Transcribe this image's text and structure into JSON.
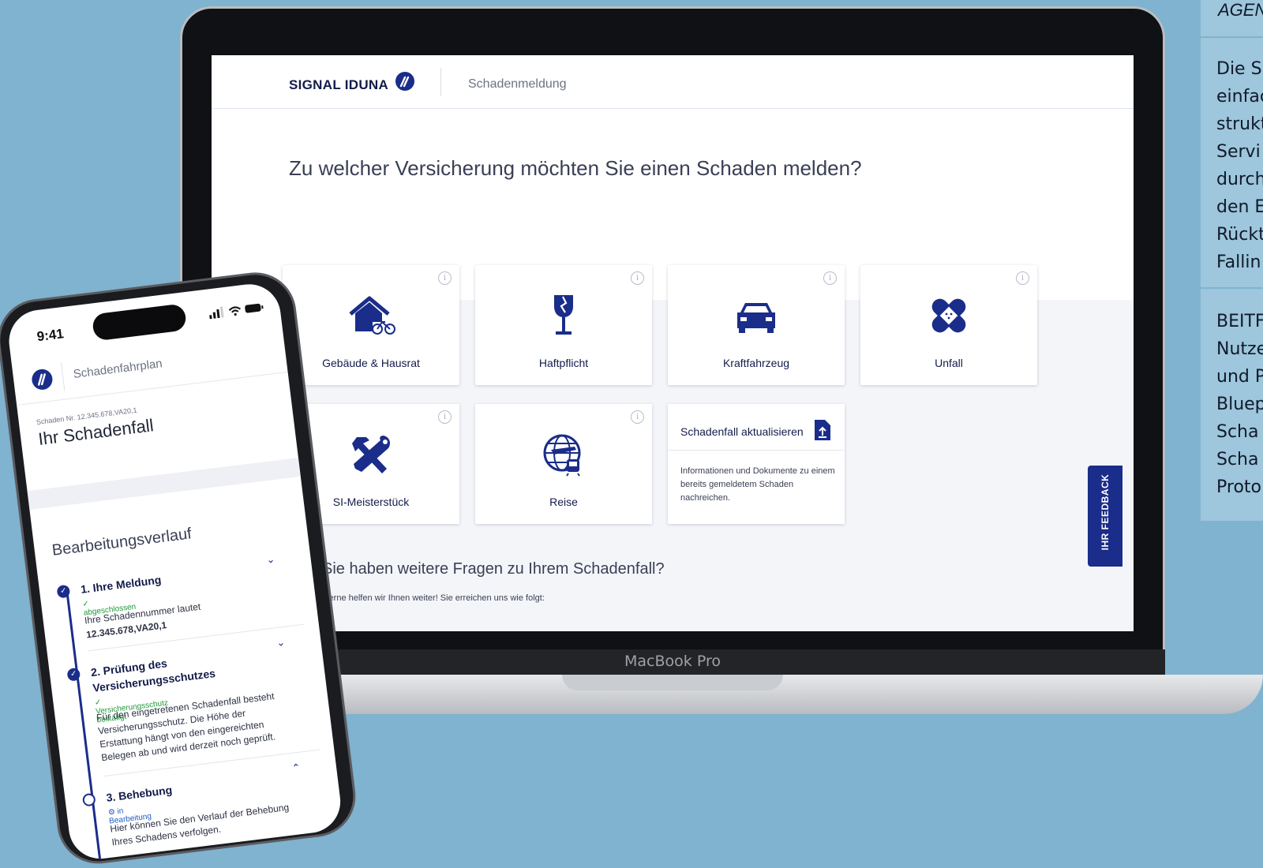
{
  "side_panel": {
    "agency": "AGEN",
    "intro_lines": "Die S\neinfac\nstrukt\nServi\ndurch\nden E\nRückt\nFallin",
    "contribution_lines": "BEITF\nNutze\nund P\nBluep\nScha\nScha\nProto"
  },
  "laptop": {
    "model_label": "MacBook Pro",
    "brand": "SIGNAL IDUNA",
    "section": "Schadenmeldung",
    "headline": "Zu welcher Versicherung möchten Sie einen Schaden melden?",
    "info_glyph": "i",
    "cards": [
      {
        "label": "Gebäude & Hausrat",
        "icon": "house-bicycle-icon"
      },
      {
        "label": "Haftpflicht",
        "icon": "broken-glass-icon"
      },
      {
        "label": "Kraftfahrzeug",
        "icon": "car-icon"
      },
      {
        "label": "Unfall",
        "icon": "bandage-icon"
      },
      {
        "label": "SI-Meisterstück",
        "icon": "tools-icon"
      },
      {
        "label": "Reise",
        "icon": "globe-travel-icon"
      }
    ],
    "update_card": {
      "title": "Schadenfall aktualisieren",
      "description": "Informationen und Dokumente zu einem bereits gemeldetem Schaden nachreichen.",
      "icon": "upload-document-icon"
    },
    "feedback_label": "IHR FEEDBACK",
    "faq_question": "Sie haben weitere Fragen zu Ihrem Schadenfall?",
    "faq_answer": "Gerne helfen wir Ihnen weiter! Sie erreichen uns wie folgt:",
    "colors": {
      "brand_blue": "#1a2d8a",
      "text_dark": "#131b4a",
      "bg_light": "#f4f5f9"
    }
  },
  "phone": {
    "time": "9:41",
    "section": "Schadenfahrplan",
    "claim_number": "Schaden Nr. 12.345.678,VA20,1",
    "title": "Ihr Schadenfall",
    "history_heading": "Bearbeitungsverlauf",
    "steps": [
      {
        "title": "1. Ihre Meldung",
        "status": "abgeschlossen",
        "text": "Ihre Schadennummer lautet",
        "value": "12.345.678,VA20,1",
        "state": "done"
      },
      {
        "title": "2. Prüfung des Versicherungsschutzes",
        "status": "Versicherungsschutz bestätigt",
        "text": "Für den eingetretenen Schadenfall besteht Versicherungsschutz. Die Höhe der Erstattung hängt von den eingereichten Belegen ab und wird derzeit noch geprüft.",
        "state": "done"
      },
      {
        "title": "3. Behebung",
        "status": "in Bearbeitung",
        "text": "Hier können Sie den Verlauf der Behebung Ihres Schadens verfolgen.",
        "state": "in_progress"
      }
    ],
    "status_colors": {
      "done": "#1f9a3a",
      "in_progress": "#1f5bc5"
    }
  }
}
